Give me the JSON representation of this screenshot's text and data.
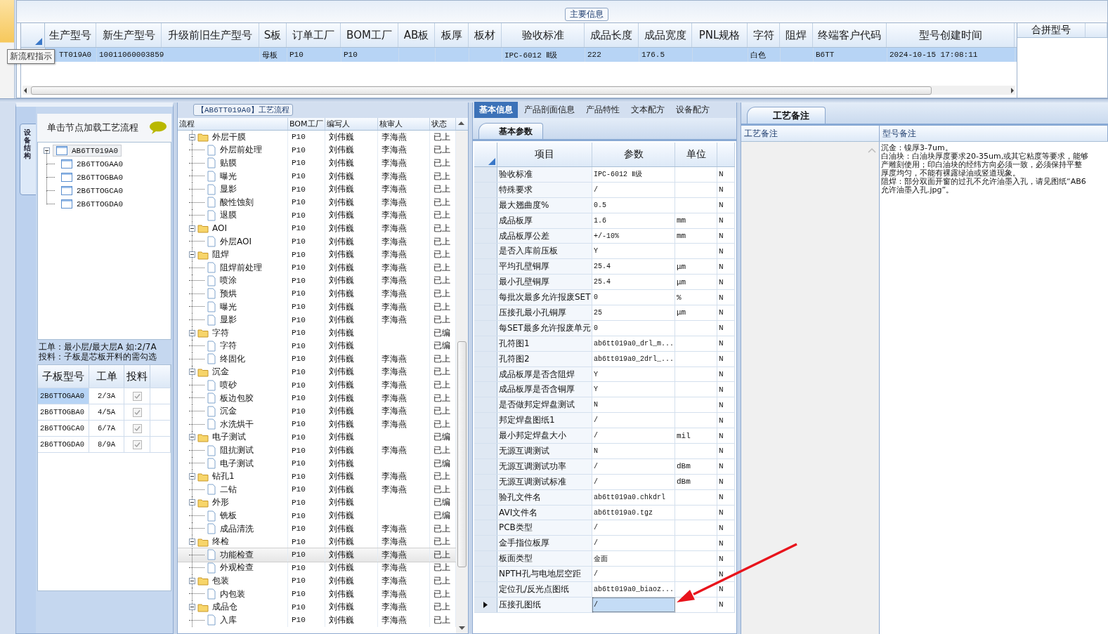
{
  "main_info": {
    "title": "主要信息",
    "tooltip": "新流程指示",
    "columns": [
      "生产型号",
      "新生产型号",
      "升级前旧生产型号",
      "S板",
      "订单工厂",
      "BOM工厂",
      "AB板",
      "板厚",
      "板材",
      "验收标准",
      "成品长度",
      "成品宽度",
      "PNL规格",
      "字符",
      "阻焊",
      "终端客户代码",
      "型号创建时间"
    ],
    "rows": [
      {
        "selected": true,
        "cells": [
          "TT019A0",
          "10011060003859",
          null,
          "母板",
          "P10",
          "P10",
          null,
          null,
          null,
          "IPC-6012 Ⅱ级",
          "222",
          "176.5",
          null,
          "白色",
          null,
          "B6TT",
          "2024-10-15 17:08:11"
        ]
      }
    ],
    "side_columns": [
      "合拼型号"
    ]
  },
  "structure": {
    "tab": "设备结构",
    "hint": "单击节点加载工艺流程",
    "tree": [
      {
        "label": "AB6TT019A0",
        "selected": true,
        "children": [
          {
            "label": "2B6TTOGAA0",
            "selected": false
          },
          {
            "label": "2B6TTOGBA0",
            "selected": false
          },
          {
            "label": "2B6TTOGCA0",
            "selected": false
          },
          {
            "label": "2B6TTOGDA0",
            "selected": false
          }
        ]
      }
    ],
    "notes": [
      "工单：最小层/最大层A 如:2/7A",
      "投料：子板是芯板开料的需勾选"
    ],
    "boards": {
      "columns": [
        "子板型号",
        "工单",
        "投料"
      ],
      "rows": [
        {
          "board": "2B6TTOGAA0",
          "order": "2/3A",
          "feed": true,
          "selected": true
        },
        {
          "board": "2B6TTOGBA0",
          "order": "4/5A",
          "feed": true,
          "selected": false
        },
        {
          "board": "2B6TTOGCA0",
          "order": "6/7A",
          "feed": true,
          "selected": false
        },
        {
          "board": "2B6TTOGDA0",
          "order": "8/9A",
          "feed": true,
          "selected": false
        }
      ]
    }
  },
  "process": {
    "title": "【AB6TT019A0】工艺流程",
    "columns": [
      "流程",
      "BOM工厂",
      "编写人",
      "核审人",
      "状态"
    ],
    "steps": [
      {
        "label": "外层干膜",
        "bom": "P10",
        "writer": "刘伟巍",
        "reviewer": "李海燕",
        "status": "已上",
        "selected": false,
        "children": [
          {
            "label": "外层前处理",
            "bom": "P10",
            "writer": "刘伟巍",
            "reviewer": "李海燕",
            "status": "已上",
            "selected": false
          },
          {
            "label": "贴膜",
            "bom": "P10",
            "writer": "刘伟巍",
            "reviewer": "李海燕",
            "status": "已上",
            "selected": false
          },
          {
            "label": "曝光",
            "bom": "P10",
            "writer": "刘伟巍",
            "reviewer": "李海燕",
            "status": "已上",
            "selected": false
          },
          {
            "label": "显影",
            "bom": "P10",
            "writer": "刘伟巍",
            "reviewer": "李海燕",
            "status": "已上",
            "selected": false
          },
          {
            "label": "酸性蚀刻",
            "bom": "P10",
            "writer": "刘伟巍",
            "reviewer": "李海燕",
            "status": "已上",
            "selected": false
          },
          {
            "label": "退膜",
            "bom": "P10",
            "writer": "刘伟巍",
            "reviewer": "李海燕",
            "status": "已上",
            "selected": false
          }
        ]
      },
      {
        "label": "AOI",
        "bom": "P10",
        "writer": "刘伟巍",
        "reviewer": "李海燕",
        "status": "已上",
        "selected": false,
        "children": [
          {
            "label": "外层AOI",
            "bom": "P10",
            "writer": "刘伟巍",
            "reviewer": "李海燕",
            "status": "已上",
            "selected": false
          }
        ]
      },
      {
        "label": "阻焊",
        "bom": "P10",
        "writer": "刘伟巍",
        "reviewer": "李海燕",
        "status": "已上",
        "selected": false,
        "children": [
          {
            "label": "阻焊前处理",
            "bom": "P10",
            "writer": "刘伟巍",
            "reviewer": "李海燕",
            "status": "已上",
            "selected": false
          },
          {
            "label": "喷涂",
            "bom": "P10",
            "writer": "刘伟巍",
            "reviewer": "李海燕",
            "status": "已上",
            "selected": false
          },
          {
            "label": "预烘",
            "bom": "P10",
            "writer": "刘伟巍",
            "reviewer": "李海燕",
            "status": "已上",
            "selected": false
          },
          {
            "label": "曝光",
            "bom": "P10",
            "writer": "刘伟巍",
            "reviewer": "李海燕",
            "status": "已上",
            "selected": false
          },
          {
            "label": "显影",
            "bom": "P10",
            "writer": "刘伟巍",
            "reviewer": "李海燕",
            "status": "已上",
            "selected": false
          }
        ]
      },
      {
        "label": "字符",
        "bom": "P10",
        "writer": "刘伟巍",
        "status": "已编",
        "selected": false,
        "children": [
          {
            "label": "字符",
            "bom": "P10",
            "writer": "刘伟巍",
            "status": "已编",
            "selected": false
          },
          {
            "label": "终固化",
            "bom": "P10",
            "writer": "刘伟巍",
            "reviewer": "李海燕",
            "status": "已上",
            "selected": false
          }
        ]
      },
      {
        "label": "沉金",
        "bom": "P10",
        "writer": "刘伟巍",
        "reviewer": "李海燕",
        "status": "已上",
        "selected": false,
        "children": [
          {
            "label": "喷砂",
            "bom": "P10",
            "writer": "刘伟巍",
            "reviewer": "李海燕",
            "status": "已上",
            "selected": false
          },
          {
            "label": "板边包胶",
            "bom": "P10",
            "writer": "刘伟巍",
            "reviewer": "李海燕",
            "status": "已上",
            "selected": false
          },
          {
            "label": "沉金",
            "bom": "P10",
            "writer": "刘伟巍",
            "reviewer": "李海燕",
            "status": "已上",
            "selected": false
          },
          {
            "label": "水洗烘干",
            "bom": "P10",
            "writer": "刘伟巍",
            "reviewer": "李海燕",
            "status": "已上",
            "selected": false
          }
        ]
      },
      {
        "label": "电子测试",
        "bom": "P10",
        "writer": "刘伟巍",
        "status": "已编",
        "selected": false,
        "children": [
          {
            "label": "阻抗测试",
            "bom": "P10",
            "writer": "刘伟巍",
            "reviewer": "李海燕",
            "status": "已上",
            "selected": false
          },
          {
            "label": "电子测试",
            "bom": "P10",
            "writer": "刘伟巍",
            "status": "已编",
            "selected": false
          }
        ]
      },
      {
        "label": "钻孔1",
        "bom": "P10",
        "writer": "刘伟巍",
        "reviewer": "李海燕",
        "status": "已上",
        "selected": false,
        "children": [
          {
            "label": "二钻",
            "bom": "P10",
            "writer": "刘伟巍",
            "reviewer": "李海燕",
            "status": "已上",
            "selected": false
          }
        ]
      },
      {
        "label": "外形",
        "bom": "P10",
        "writer": "刘伟巍",
        "status": "已编",
        "selected": false,
        "children": [
          {
            "label": "铣板",
            "bom": "P10",
            "writer": "刘伟巍",
            "status": "已编",
            "selected": false
          },
          {
            "label": "成品清洗",
            "bom": "P10",
            "writer": "刘伟巍",
            "reviewer": "李海燕",
            "status": "已上",
            "selected": false
          }
        ]
      },
      {
        "label": "终检",
        "bom": "P10",
        "writer": "刘伟巍",
        "reviewer": "李海燕",
        "status": "已上",
        "selected": false,
        "children": [
          {
            "label": "功能检查",
            "bom": "P10",
            "writer": "刘伟巍",
            "reviewer": "李海燕",
            "status": "已上",
            "selected": true
          },
          {
            "label": "外观检查",
            "bom": "P10",
            "writer": "刘伟巍",
            "reviewer": "李海燕",
            "status": "已上",
            "selected": false
          }
        ]
      },
      {
        "label": "包装",
        "bom": "P10",
        "writer": "刘伟巍",
        "reviewer": "李海燕",
        "status": "已上",
        "selected": false,
        "children": [
          {
            "label": "内包装",
            "bom": "P10",
            "writer": "刘伟巍",
            "reviewer": "李海燕",
            "status": "已上",
            "selected": false
          }
        ]
      },
      {
        "label": "成品仓",
        "bom": "P10",
        "writer": "刘伟巍",
        "reviewer": "李海燕",
        "status": "已上",
        "selected": false,
        "children": [
          {
            "label": "入库",
            "bom": "P10",
            "writer": "刘伟巍",
            "reviewer": "李海燕",
            "status": "已上",
            "selected": false
          }
        ]
      }
    ]
  },
  "params": {
    "tabs": [
      {
        "label": "基本信息",
        "selected": true
      },
      {
        "label": "产品剖面信息",
        "selected": false
      },
      {
        "label": "产品特性",
        "selected": false
      },
      {
        "label": "文本配方",
        "selected": false
      },
      {
        "label": "设备配方",
        "selected": false
      }
    ],
    "subtab": "基本参数",
    "columns": [
      "项目",
      "参数",
      "单位"
    ],
    "rows": [
      {
        "item": "验收标准",
        "value": "IPC-6012 Ⅱ级",
        "flag": "N",
        "selected": false
      },
      {
        "item": "特殊要求",
        "value": "/",
        "flag": "N",
        "selected": false
      },
      {
        "item": "最大翘曲度%",
        "value": "0.5",
        "flag": "N",
        "selected": false
      },
      {
        "item": "成品板厚",
        "value": "1.6",
        "unit": "mm",
        "flag": "N",
        "selected": false
      },
      {
        "item": "成品板厚公差",
        "value": "+/-10%",
        "unit": "mm",
        "flag": "N",
        "selected": false
      },
      {
        "item": "是否入库前压板",
        "value": "Y",
        "flag": "N",
        "selected": false
      },
      {
        "item": "平均孔壁铜厚",
        "value": "25.4",
        "unit": "μm",
        "flag": "N",
        "selected": false
      },
      {
        "item": "最小孔壁铜厚",
        "value": "25.4",
        "unit": "μm",
        "flag": "N",
        "selected": false
      },
      {
        "item": "每批次最多允许报废SET",
        "value": "0",
        "unit": "%",
        "flag": "N",
        "selected": false
      },
      {
        "item": "压接孔最小孔铜厚",
        "value": "25",
        "unit": "μm",
        "flag": "N",
        "selected": false
      },
      {
        "item": "每SET最多允许报废单元",
        "value": "0",
        "flag": "N",
        "selected": false
      },
      {
        "item": "孔符图1",
        "value": "ab6tt019a0_drl_m...",
        "flag": "N",
        "selected": false
      },
      {
        "item": "孔符图2",
        "value": "ab6tt019a0_2drl_...",
        "flag": "N",
        "selected": false
      },
      {
        "item": "成品板厚是否含阻焊",
        "value": "Y",
        "flag": "N",
        "selected": false
      },
      {
        "item": "成品板厚是否含铜厚",
        "value": "Y",
        "flag": "N",
        "selected": false
      },
      {
        "item": "是否做邦定焊盘测试",
        "value": "N",
        "flag": "N",
        "selected": false
      },
      {
        "item": "邦定焊盘图纸1",
        "value": "/",
        "flag": "N",
        "selected": false
      },
      {
        "item": "最小邦定焊盘大小",
        "value": "/",
        "unit": "mil",
        "flag": "N",
        "selected": false
      },
      {
        "item": "无源互调测试",
        "value": "N",
        "flag": "N",
        "selected": false
      },
      {
        "item": "无源互调测试功率",
        "value": "/",
        "unit": "dBm",
        "flag": "N",
        "selected": false
      },
      {
        "item": "无源互调测试标准",
        "value": "/",
        "unit": "dBm",
        "flag": "N",
        "selected": false
      },
      {
        "item": "验孔文件名",
        "value": "ab6tt019a0.chkdrl",
        "flag": "N",
        "selected": false
      },
      {
        "item": "AVI文件名",
        "value": "ab6tt019a0.tgz",
        "flag": "N",
        "selected": false
      },
      {
        "item": "PCB类型",
        "value": "/",
        "flag": "N",
        "selected": false
      },
      {
        "item": "金手指位板厚",
        "value": "/",
        "flag": "N",
        "selected": false
      },
      {
        "item": "板面类型",
        "value": "金面",
        "flag": "N",
        "selected": false
      },
      {
        "item": "NPTH孔与电地层空距",
        "value": "/",
        "flag": "N",
        "selected": false
      },
      {
        "item": "定位孔/反光点图纸",
        "value": "ab6tt019a0_biaoz...",
        "flag": "N",
        "selected": false
      },
      {
        "item": "压接孔图纸",
        "value": "/",
        "flag": "N",
        "selected": true
      }
    ]
  },
  "remarks": {
    "tab": "工艺备注",
    "columns": [
      "工艺备注",
      "型号备注"
    ],
    "lines": [
      "沉金：镍厚3-7um。",
      "白油块：白油块厚度要求20-35um,或其它粘度等要求，能够",
      "产雕刻使用；印白油块的经纬方向必须一致，必须保持平整",
      "厚度均匀，不能有裸露绿油或竖道现象。",
      "阻焊：部分双面开窗的过孔不允许油墨入孔，请见图纸“AB6",
      "允许油墨入孔.jpg”。"
    ]
  },
  "annotation": {
    "kind": "arrow"
  }
}
